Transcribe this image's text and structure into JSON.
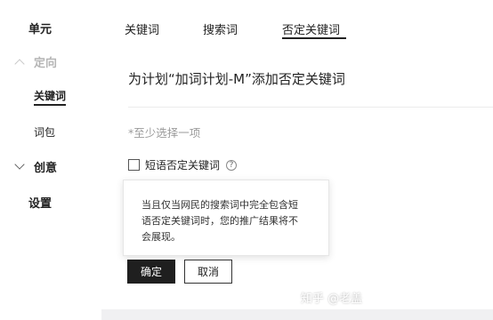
{
  "sidebar": {
    "unit": "单元",
    "targeting": "定向",
    "keywords": "关键词",
    "word_pack": "词包",
    "creative": "创意",
    "settings": "设置"
  },
  "tabs": [
    {
      "label": "关键词"
    },
    {
      "label": "搜索词"
    },
    {
      "label": "否定关键词",
      "active": true
    }
  ],
  "main": {
    "title": "为计划“加词计划-M”添加否定关键词",
    "hint": "*至少选择一项",
    "checkbox_label": "短语否定关键词",
    "checkbox_checked": false,
    "help_icon": "?",
    "tooltip_lines": [
      "当且仅当网民的搜索词中完全包含短",
      "语否定关键词时，您的推广结果将不",
      "会展现。"
    ],
    "confirm_label": "确定",
    "cancel_label": "取消"
  },
  "watermark": "知乎 @老盖",
  "colors": {
    "primary_button": "#1f1f1f",
    "page_background": "#f5f5f7",
    "muted_text": "#9b9b9b"
  }
}
